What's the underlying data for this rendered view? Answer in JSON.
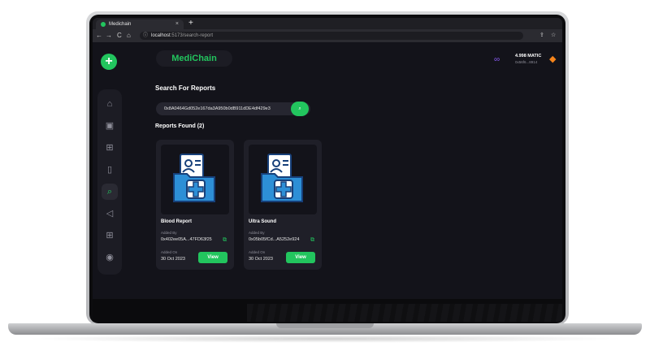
{
  "browser": {
    "tab_title": "Medichain",
    "tab_close": "×",
    "new_tab": "+",
    "nav_back": "←",
    "nav_forward": "→",
    "nav_reload": "C",
    "nav_home": "⌂",
    "url_host": "localhost",
    "url_path": ":5173/search-report",
    "share_icon": "⇪",
    "bookmark_icon": "☆"
  },
  "app": {
    "brand": "MediChain",
    "wallet": {
      "balance": "4.998 MATIC",
      "address": "0x56f6...8914"
    },
    "search": {
      "heading": "Search For Reports",
      "value": "0x8A0464Gd052e167da3A950b0dB911dDE4df429e3"
    },
    "results_heading": "Reports Found (2)",
    "reports": [
      {
        "name": "Blood Report",
        "added_by_label": "Added By",
        "added_by": "0x402ee05A...47FD63f25",
        "added_on_label": "Added On",
        "added_on": "30 Oct 2023",
        "view_label": "View"
      },
      {
        "name": "Ultra Sound",
        "added_by_label": "Added By",
        "added_by": "0x05b05fCd...A5252e924",
        "added_on_label": "Added On",
        "added_on": "30 Oct 2023",
        "view_label": "View"
      }
    ],
    "sidebar_icons": [
      "home-icon",
      "briefcase-icon",
      "file-add-icon",
      "file-icon",
      "file-search-icon",
      "megaphone-icon",
      "grid-icon",
      "user-icon"
    ]
  },
  "colors": {
    "accent": "#22c55e",
    "background": "#13131a",
    "panel": "#1c1c24",
    "card": "#1f1f28",
    "text": "#ffffff"
  }
}
